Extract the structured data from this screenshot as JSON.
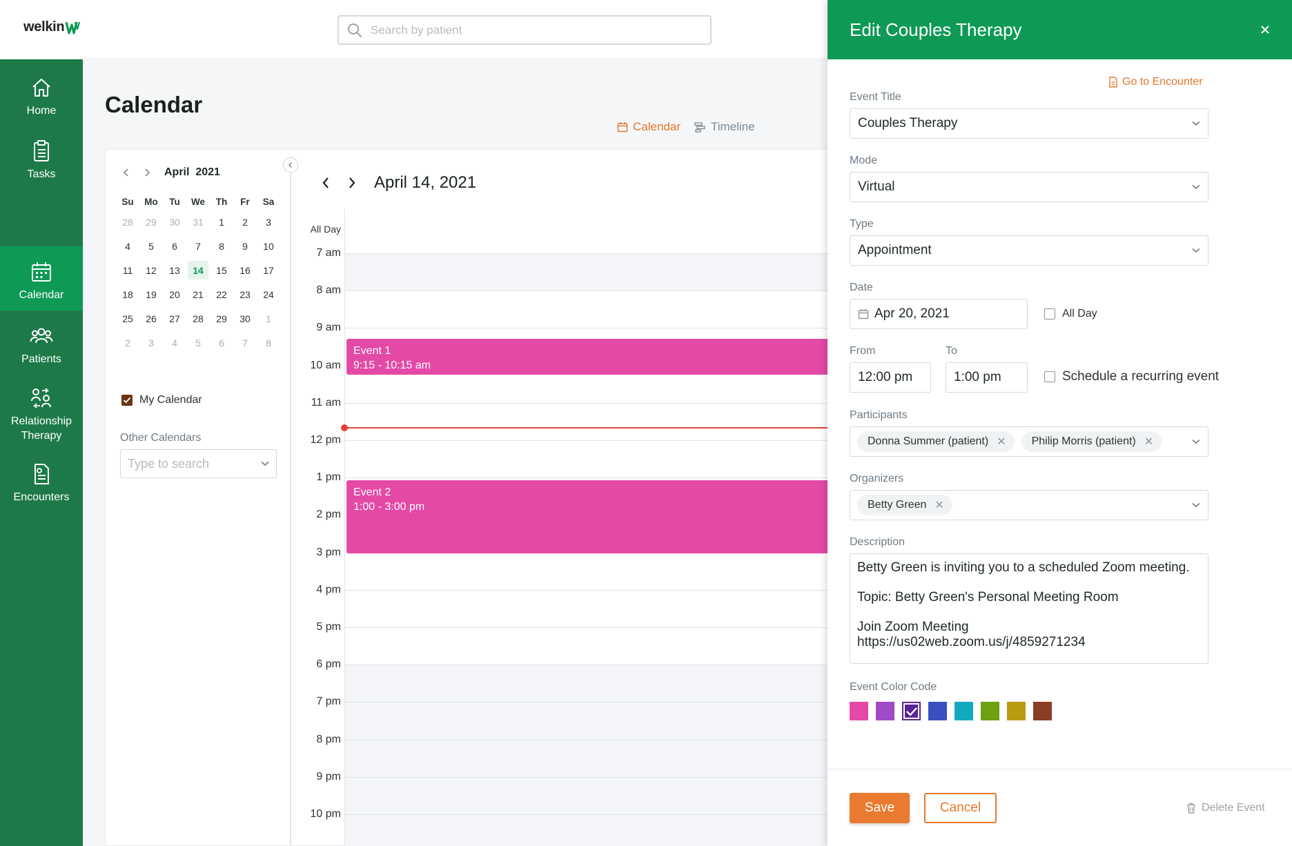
{
  "brand": {
    "name": "welkin"
  },
  "search": {
    "placeholder": "Search by patient"
  },
  "sidebar": {
    "items": [
      {
        "label": "Home",
        "icon": "home-icon"
      },
      {
        "label": "Tasks",
        "icon": "clipboard-icon"
      },
      {
        "label": "Calendar",
        "icon": "calendar-icon",
        "active": true
      },
      {
        "label": "Patients",
        "icon": "users-icon"
      },
      {
        "label": "Relationship\nTherapy",
        "icon": "relationship-icon"
      },
      {
        "label": "Encounters",
        "icon": "document-icon"
      }
    ]
  },
  "page": {
    "title": "Calendar"
  },
  "view_toggle": {
    "calendar": "Calendar",
    "timeline": "Timeline"
  },
  "mini_calendar": {
    "month_label": "April  2021",
    "weekdays": [
      "Su",
      "Mo",
      "Tu",
      "We",
      "Th",
      "Fr",
      "Sa"
    ],
    "weeks": [
      [
        "28",
        "29",
        "30",
        "31",
        "1",
        "2",
        "3"
      ],
      [
        "4",
        "5",
        "6",
        "7",
        "8",
        "9",
        "10"
      ],
      [
        "11",
        "12",
        "13",
        "14",
        "15",
        "16",
        "17"
      ],
      [
        "18",
        "19",
        "20",
        "21",
        "22",
        "23",
        "24"
      ],
      [
        "25",
        "26",
        "27",
        "28",
        "29",
        "30",
        "1"
      ],
      [
        "2",
        "3",
        "4",
        "5",
        "6",
        "7",
        "8"
      ]
    ],
    "today": "14"
  },
  "calendars": {
    "my_calendar": "My Calendar",
    "other_label": "Other Calendars",
    "other_placeholder": "Type to search",
    "my_calendar_color": "#6b3317"
  },
  "day_view": {
    "date_title": "April 14, 2021",
    "all_day_label": "All Day",
    "hours": [
      "7 am",
      "8 am",
      "9 am",
      "10 am",
      "11 am",
      "12 pm",
      "1 pm",
      "2 pm",
      "3 pm",
      "4 pm",
      "5 pm",
      "6 pm",
      "7 pm",
      "8 pm",
      "9 pm",
      "10 pm"
    ],
    "events": [
      {
        "title": "Event 1",
        "time": "9:15 - 10:15 am",
        "color": "#e449a6"
      },
      {
        "title": "Event 2",
        "time": "1:00 - 3:00 pm",
        "color": "#e449a6"
      }
    ]
  },
  "panel": {
    "title": "Edit Couples Therapy",
    "goto_encounter": "Go to Encounter",
    "event_title": {
      "label": "Event Title",
      "value": "Couples Therapy"
    },
    "mode": {
      "label": "Mode",
      "value": "Virtual"
    },
    "type": {
      "label": "Type",
      "value": "Appointment"
    },
    "date": {
      "label": "Date",
      "value": "Apr 20, 2021",
      "all_day_label": "All Day"
    },
    "from": {
      "label": "From",
      "value": "12:00 pm"
    },
    "to": {
      "label": "To",
      "value": "1:00 pm"
    },
    "recurring_label": "Schedule a recurring event",
    "participants": {
      "label": "Participants",
      "chips": [
        "Donna Summer (patient)",
        "Philip Morris (patient)"
      ]
    },
    "organizers": {
      "label": "Organizers",
      "chips": [
        "Betty Green"
      ]
    },
    "description": {
      "label": "Description",
      "lines": [
        "Betty Green is inviting you to a scheduled Zoom meeting.",
        "",
        "Topic: Betty Green's Personal Meeting Room",
        "",
        "Join Zoom Meeting",
        "https://us02web.zoom.us/j/4859271234"
      ]
    },
    "color_code": {
      "label": "Event Color Code",
      "swatches": [
        "#e449a6",
        "#a04ac8",
        "#5a2596",
        "#3b4fc2",
        "#12a9bf",
        "#6da10f",
        "#b99b0e",
        "#8a3f24"
      ],
      "selected_index": 2
    },
    "save_label": "Save",
    "cancel_label": "Cancel",
    "delete_label": "Delete Event"
  }
}
